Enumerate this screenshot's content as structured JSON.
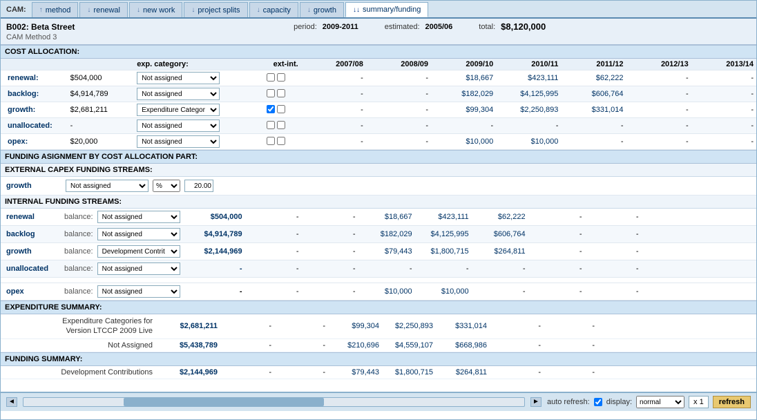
{
  "tabs": {
    "cam_label": "CAM:",
    "items": [
      {
        "id": "method",
        "label": "method",
        "active": false,
        "arrow": "↑"
      },
      {
        "id": "renewal",
        "label": "renewal",
        "active": false,
        "arrow": "↓"
      },
      {
        "id": "new_work",
        "label": "new work",
        "active": false,
        "arrow": "↓"
      },
      {
        "id": "project_splits",
        "label": "project splits",
        "active": false,
        "arrow": "↓"
      },
      {
        "id": "capacity",
        "label": "capacity",
        "active": false,
        "arrow": "↓"
      },
      {
        "id": "growth",
        "label": "growth",
        "active": false,
        "arrow": "↓"
      },
      {
        "id": "summary_funding",
        "label": "summary/funding",
        "active": true,
        "arrow": "↓↓"
      }
    ]
  },
  "header": {
    "title": "B002: Beta Street",
    "subtitle": "CAM Method 3",
    "period_label": "period:",
    "period_value": "2009-2011",
    "estimated_label": "estimated:",
    "estimated_value": "2005/06",
    "total_label": "total:",
    "total_value": "$8,120,000"
  },
  "cost_allocation": {
    "section_label": "COST ALLOCATION:",
    "exp_category_label": "exp. category:",
    "ext_int_label": "ext-int.",
    "columns": [
      "2007/08",
      "2008/09",
      "2009/10",
      "2010/11",
      "2011/12",
      "2012/13",
      "2013/14"
    ],
    "rows": [
      {
        "label": "renewal:",
        "amount": "$504,000",
        "category": "Not assigned",
        "ext": false,
        "int": false,
        "years": [
          "-",
          "-",
          "$18,667",
          "$423,111",
          "$62,222",
          "-",
          "-"
        ]
      },
      {
        "label": "backlog:",
        "amount": "$4,914,789",
        "category": "Not assigned",
        "ext": false,
        "int": false,
        "years": [
          "-",
          "-",
          "$182,029",
          "$4,125,995",
          "$606,764",
          "-",
          "-"
        ]
      },
      {
        "label": "growth:",
        "amount": "$2,681,211",
        "category": "Expenditure Categor",
        "ext": true,
        "int": false,
        "years": [
          "-",
          "-",
          "$99,304",
          "$2,250,893",
          "$331,014",
          "-",
          "-"
        ]
      },
      {
        "label": "unallocated:",
        "amount": "-",
        "category": "Not assigned",
        "ext": false,
        "int": false,
        "years": [
          "-",
          "-",
          "-",
          "-",
          "-",
          "-",
          "-"
        ]
      },
      {
        "label": "opex:",
        "amount": "$20,000",
        "category": "Not assigned",
        "ext": false,
        "int": false,
        "years": [
          "-",
          "-",
          "$10,000",
          "$10,000",
          "-",
          "-",
          "-"
        ]
      }
    ]
  },
  "funding_assignment": {
    "section_label": "FUNDING ASIGNMENT BY COST ALLOCATION PART:"
  },
  "external_capex": {
    "section_label": "EXTERNAL CAPEX FUNDING STREAMS:",
    "rows": [
      {
        "label": "growth",
        "category": "Not assigned",
        "pct": "%",
        "value": "20.00"
      }
    ]
  },
  "internal_funding": {
    "section_label": "INTERNAL FUNDING STREAMS:",
    "rows": [
      {
        "label": "renewal",
        "balance_label": "balance:",
        "category": "Not assigned",
        "amount": "$504,000",
        "years": [
          "-",
          "-",
          "$18,667",
          "$423,111",
          "$62,222",
          "-",
          "-"
        ]
      },
      {
        "label": "backlog",
        "balance_label": "balance:",
        "category": "Not assigned",
        "amount": "$4,914,789",
        "years": [
          "-",
          "-",
          "$182,029",
          "$4,125,995",
          "$606,764",
          "-",
          "-"
        ]
      },
      {
        "label": "growth",
        "balance_label": "balance:",
        "category": "Development Contrit",
        "amount": "$2,144,969",
        "years": [
          "-",
          "-",
          "$79,443",
          "$1,800,715",
          "$264,811",
          "-",
          "-"
        ]
      },
      {
        "label": "unallocated",
        "balance_label": "balance:",
        "category": "Not assigned",
        "amount": "-",
        "years": [
          "-",
          "-",
          "-",
          "-",
          "-",
          "-",
          "-"
        ]
      },
      {
        "label": "opex",
        "balance_label": "balance:",
        "category": "Not assigned",
        "amount": "-",
        "years": [
          "-",
          "-",
          "$10,000",
          "$10,000",
          "-",
          "-",
          "-"
        ]
      }
    ]
  },
  "expenditure_summary": {
    "section_label": "EXPENDITURE SUMMARY:",
    "rows": [
      {
        "desc": "Expenditure Categories for\nVersion LTCCP 2009 Live",
        "amount": "$2,681,211",
        "years": [
          "-",
          "-",
          "$99,304",
          "$2,250,893",
          "$331,014",
          "-",
          "-"
        ]
      },
      {
        "desc": "Not Assigned",
        "amount": "$5,438,789",
        "years": [
          "-",
          "-",
          "$210,696",
          "$4,559,107",
          "$668,986",
          "-",
          "-"
        ]
      }
    ]
  },
  "funding_summary": {
    "section_label": "FUNDING SUMMARY:",
    "rows": [
      {
        "desc": "Development Contributions",
        "amount": "$2,144,969",
        "years": [
          "-",
          "-",
          "$79,443",
          "$1,800,715",
          "$264,811",
          "-",
          "-"
        ]
      }
    ]
  },
  "bottom": {
    "auto_refresh_label": "auto refresh:",
    "display_label": "display:",
    "display_value": "normal",
    "x1_label": "x 1",
    "refresh_label": "refresh"
  }
}
